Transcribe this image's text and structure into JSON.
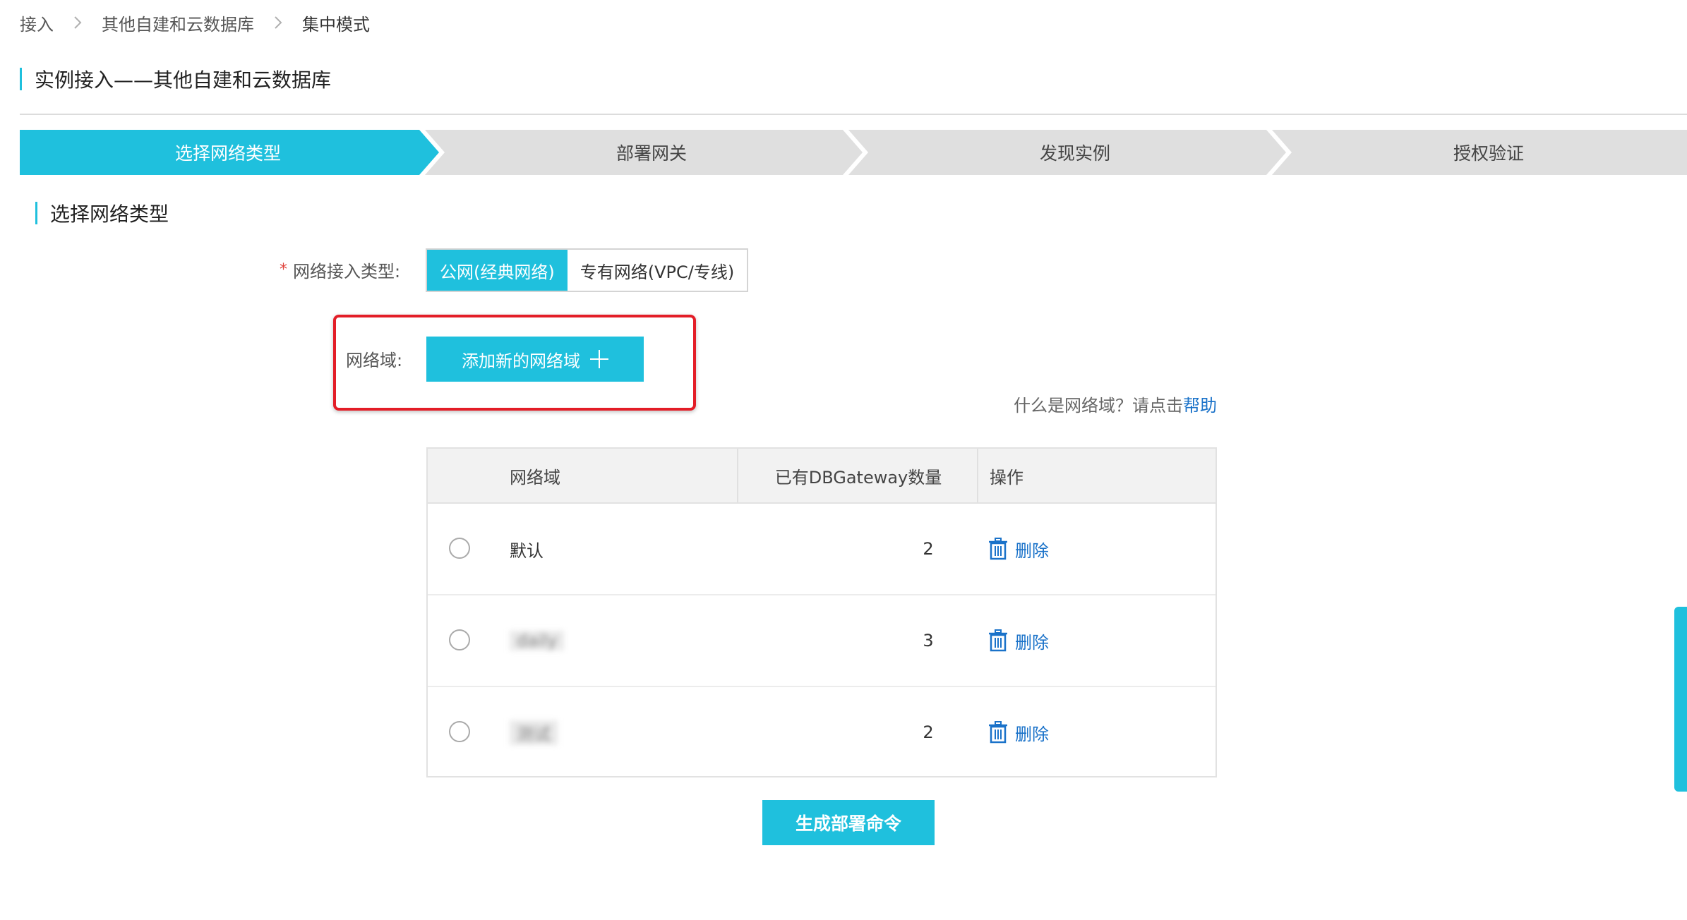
{
  "breadcrumb": {
    "items": [
      "接入",
      "其他自建和云数据库",
      "集中模式"
    ]
  },
  "page_title": "实例接入——其他自建和云数据库",
  "steps": [
    "选择网络类型",
    "部署网关",
    "发现实例",
    "授权验证"
  ],
  "section_title": "选择网络类型",
  "network_type": {
    "required_mark": "*",
    "label": "网络接入类型:",
    "options": [
      "公网(经典网络)",
      "专有网络(VPC/专线)"
    ],
    "selected": "公网(经典网络)"
  },
  "network_domain": {
    "label": "网络域:",
    "add_button": "添加新的网络域"
  },
  "help": {
    "text": "什么是网络域？请点击",
    "link": "帮助"
  },
  "table": {
    "headers": [
      "网络域",
      "已有DBGateway数量",
      "操作"
    ],
    "rows": [
      {
        "name": "默认",
        "count": "2",
        "action": "删除"
      },
      {
        "name": "daily",
        "count": "3",
        "action": "删除"
      },
      {
        "name": "测试",
        "count": "2",
        "action": "删除"
      }
    ]
  },
  "generate_button": "生成部署命令",
  "colors": {
    "accent": "#1fc0dd",
    "link": "#1a72c9",
    "highlight": "#e31d27",
    "step_inactive": "#dfdfdf"
  }
}
